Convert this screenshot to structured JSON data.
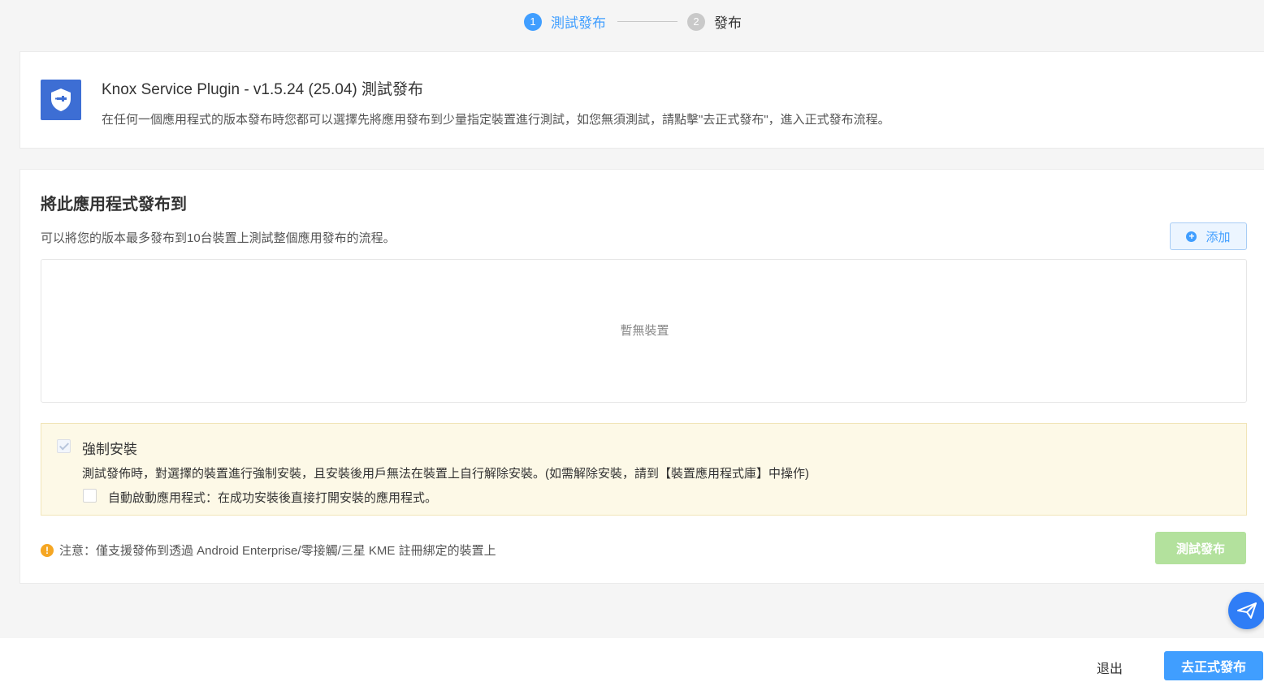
{
  "steps": [
    {
      "num": "1",
      "label": "測試發布",
      "state": "active"
    },
    {
      "num": "2",
      "label": "發布",
      "state": "inactive"
    }
  ],
  "app": {
    "icon": "shield-plug-icon",
    "title": "Knox Service Plugin - v1.5.24 (25.04) 測試發布",
    "description": "在任何一個應用程式的版本發布時您都可以選擇先將應用發布到少量指定裝置進行測試，如您無須測試，請點擊\"去正式發布\"，進入正式發布流程。"
  },
  "distribute": {
    "heading": "將此應用程式發布到",
    "subtitle": "可以將您的版本最多發布到10台裝置上測試整個應用發布的流程。",
    "add_label": "添加",
    "empty_text": "暫無裝置",
    "force_install": {
      "label": "強制安裝",
      "checked": true,
      "disabled": true,
      "description": "測試發佈時，對選擇的裝置進行強制安裝，且安裝後用戶無法在裝置上自行解除安裝。(如需解除安裝，請到【裝置應用程式庫】中操作)"
    },
    "auto_launch": {
      "label": "自動啟動應用程式：在成功安裝後直接打開安裝的應用程式。",
      "checked": false
    },
    "note_icon": "!",
    "note": "注意：僅支援發佈到透過 Android Enterprise/零接觸/三星 KME 註冊綁定的裝置上",
    "test_button": "測試發布"
  },
  "footer": {
    "exit_label": "退出",
    "publish_label": "去正式發布"
  },
  "colors": {
    "primary": "#409eff",
    "app_icon_bg": "#3d6ed4",
    "disabled_green": "#b3e19d",
    "warning_bg": "#fdf9e7",
    "note_orange": "#f5a623"
  }
}
